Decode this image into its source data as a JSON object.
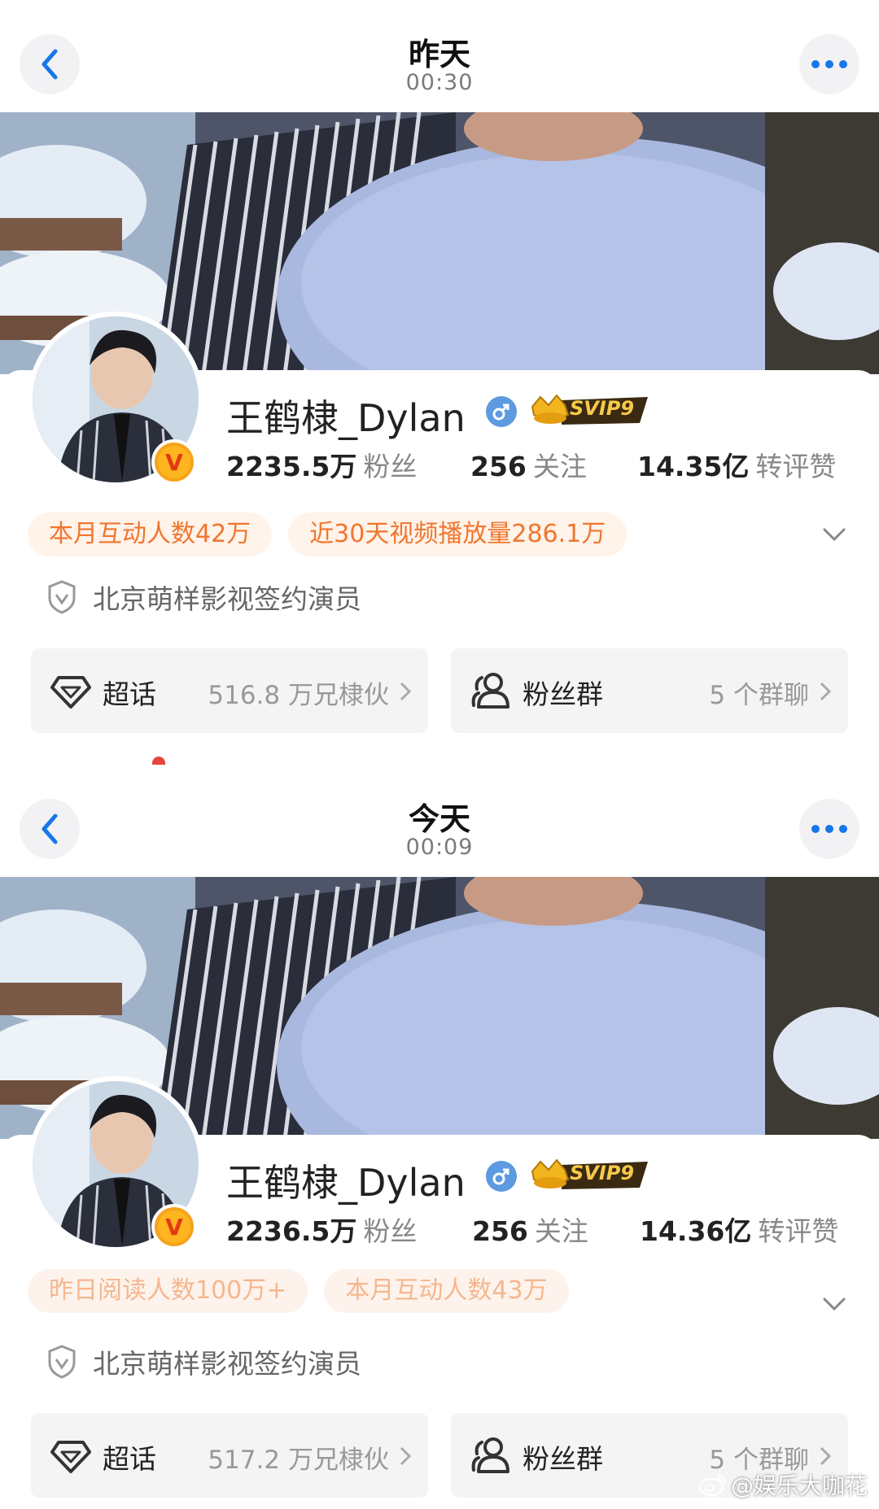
{
  "panels": [
    {
      "nav": {
        "title": "昨天",
        "time": "00:30"
      },
      "profile": {
        "name": "王鹤棣_Dylan",
        "verified_badge": "V",
        "svip_label": "SVIP9",
        "stats": [
          {
            "value": "2235.5万",
            "label": "粉丝"
          },
          {
            "value": "256",
            "label": "关注"
          },
          {
            "value": "14.35亿",
            "label": "转评赞"
          }
        ],
        "tags": [
          "本月互动人数42万",
          "近30天视频播放量286.1万"
        ],
        "certification": "北京萌样影视签约演员",
        "super_topic": {
          "title": "超话",
          "meta": "516.8 万兄棣伙"
        },
        "fan_group": {
          "title": "粉丝群",
          "meta": "5 个群聊"
        }
      }
    },
    {
      "nav": {
        "title": "今天",
        "time": "00:09"
      },
      "profile": {
        "name": "王鹤棣_Dylan",
        "verified_badge": "V",
        "svip_label": "SVIP9",
        "stats": [
          {
            "value": "2236.5万",
            "label": "粉丝"
          },
          {
            "value": "256",
            "label": "关注"
          },
          {
            "value": "14.36亿",
            "label": "转评赞"
          }
        ],
        "tags": [
          "昨日阅读人数100万+",
          "本月互动人数43万"
        ],
        "certification": "北京萌样影视签约演员",
        "super_topic": {
          "title": "超话",
          "meta": "517.2 万兄棣伙"
        },
        "fan_group": {
          "title": "粉丝群",
          "meta": "5 个群聊"
        }
      }
    }
  ],
  "watermark": "@娱乐大咖花",
  "icons": [
    "back-icon",
    "more-icon",
    "male-icon",
    "svip-crown-icon",
    "shield-icon",
    "diamond-icon",
    "group-icon",
    "chevron-down-icon",
    "chevron-right-icon",
    "weibo-icon"
  ],
  "colors": {
    "accent_blue": "#1677e8",
    "tag_orange": "#f0762e",
    "tag_bg": "#fff3ea",
    "gender_blue": "#5d9ae0",
    "badge_orange": "#f6a41c"
  }
}
